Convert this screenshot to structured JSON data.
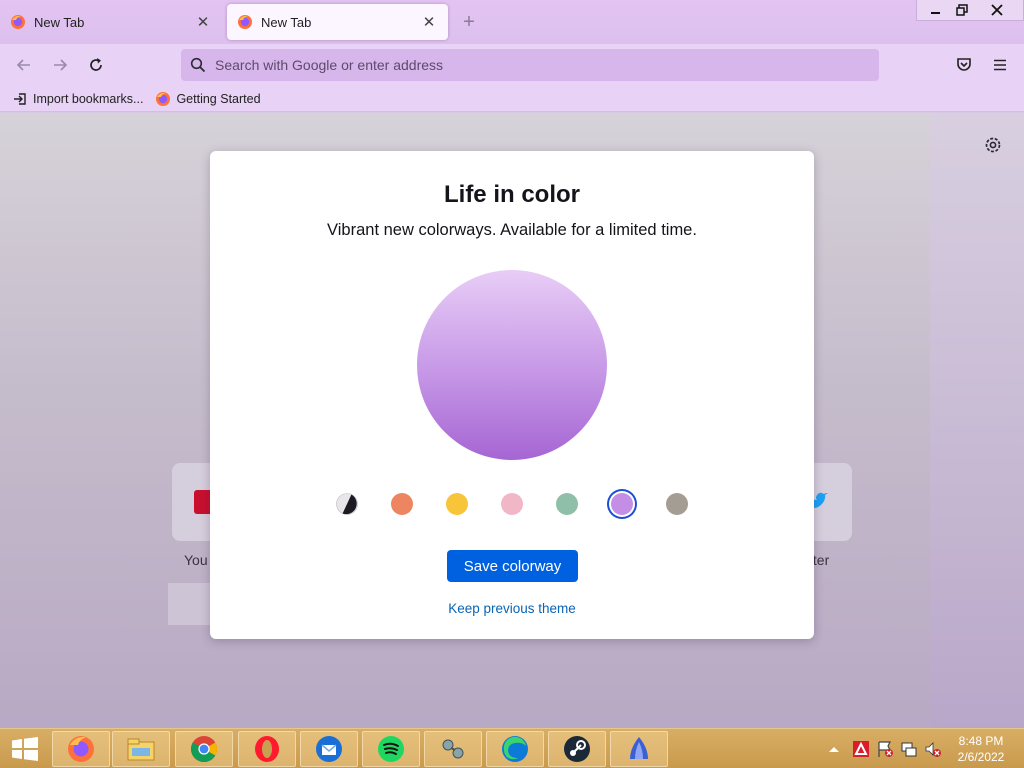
{
  "tabs": [
    {
      "label": "New Tab",
      "close": "✕"
    },
    {
      "label": "New Tab",
      "close": "✕"
    }
  ],
  "new_tab_glyph": "+",
  "window_controls": {
    "minimize": "—",
    "restore": "❐",
    "close": "✕"
  },
  "address_bar": {
    "placeholder": "Search with Google or enter address"
  },
  "bookmarks": [
    {
      "label": "Import bookmarks...",
      "icon": "import-icon"
    },
    {
      "label": "Getting Started",
      "icon": "firefox-icon"
    }
  ],
  "background_tiles": {
    "left_label": "You",
    "right_label": "tter"
  },
  "modal": {
    "title": "Life in color",
    "subtitle": "Vibrant new colorways. Available for a limited time.",
    "save_label": "Save colorway",
    "keep_label": "Keep previous theme",
    "swatches": [
      {
        "name": "dark-light",
        "color": "#2b2a33",
        "selected": false
      },
      {
        "name": "orange",
        "color": "#ec8560",
        "selected": false
      },
      {
        "name": "yellow",
        "color": "#f7c43a",
        "selected": false
      },
      {
        "name": "pink",
        "color": "#f2b7c7",
        "selected": false
      },
      {
        "name": "green",
        "color": "#8fbfa8",
        "selected": false
      },
      {
        "name": "purple",
        "color": "#c48ee6",
        "selected": true
      },
      {
        "name": "gray",
        "color": "#a39d94",
        "selected": false
      }
    ]
  },
  "colors": {
    "accent": "#0061e0",
    "link": "#0a63b4",
    "theme_purple": "#c596e6"
  },
  "taskbar": {
    "apps": [
      "firefox-icon",
      "file-explorer-icon",
      "chrome-icon",
      "opera-icon",
      "thunderbird-icon",
      "spotify-icon",
      "app-icon",
      "edge-icon",
      "steam-icon",
      "app-shell-icon"
    ],
    "time": "8:48 PM",
    "date": "2/6/2022"
  }
}
